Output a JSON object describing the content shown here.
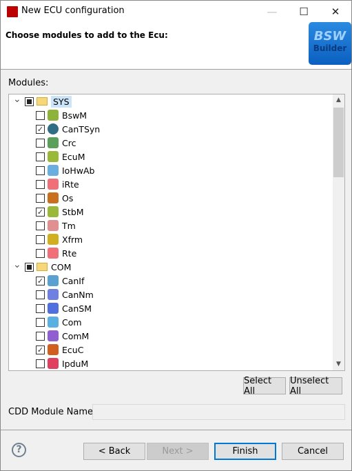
{
  "window": {
    "title": "New ECU configuration",
    "minimize": "—",
    "maximize": "☐",
    "close": "✕"
  },
  "header": {
    "heading": "Choose modules to add to the Ecu:",
    "logo_text": "BSW Builder",
    "logo_line1": "BSW",
    "logo_line2": "Builder"
  },
  "modules_label": "Modules:",
  "tree": [
    {
      "label": "SYS",
      "state": "partial",
      "expanded": true,
      "children": [
        {
          "label": "BswM",
          "checked": false,
          "icon": "bswm-icon",
          "color": "#8db33a"
        },
        {
          "label": "CanTSyn",
          "checked": true,
          "icon": "cantsyn-icon",
          "color": "#2f6e84"
        },
        {
          "label": "Crc",
          "checked": false,
          "icon": "crc-icon",
          "color": "#5aa05a"
        },
        {
          "label": "EcuM",
          "checked": false,
          "icon": "ecum-icon",
          "color": "#9ab83a"
        },
        {
          "label": "IoHwAb",
          "checked": false,
          "icon": "iohwab-icon",
          "color": "#6aaee0"
        },
        {
          "label": "iRte",
          "checked": false,
          "icon": "irte-icon",
          "color": "#f0707a"
        },
        {
          "label": "Os",
          "checked": false,
          "icon": "os-gears-icon",
          "color": "#c87020"
        },
        {
          "label": "StbM",
          "checked": true,
          "icon": "stbm-icon",
          "color": "#9ab83a"
        },
        {
          "label": "Tm",
          "checked": false,
          "icon": "tm-icon",
          "color": "#e09090"
        },
        {
          "label": "Xfrm",
          "checked": false,
          "icon": "xfrm-icon",
          "color": "#d0b020"
        },
        {
          "label": "Rte",
          "checked": false,
          "icon": "rte-icon",
          "color": "#f0707a"
        }
      ]
    },
    {
      "label": "COM",
      "state": "partial",
      "expanded": true,
      "children": [
        {
          "label": "CanIf",
          "checked": true,
          "icon": "canif-icon",
          "color": "#5aa0d0"
        },
        {
          "label": "CanNm",
          "checked": false,
          "icon": "cannm-icon",
          "color": "#7080e0"
        },
        {
          "label": "CanSM",
          "checked": false,
          "icon": "cansm-icon",
          "color": "#5070e0"
        },
        {
          "label": "Com",
          "checked": false,
          "icon": "com-icon",
          "color": "#5ab0e0"
        },
        {
          "label": "ComM",
          "checked": false,
          "icon": "comm-icon",
          "color": "#9060d0"
        },
        {
          "label": "EcuC",
          "checked": true,
          "icon": "ecuc-icon",
          "color": "#d06020"
        },
        {
          "label": "IpduM",
          "checked": false,
          "icon": "ipdum-icon",
          "color": "#e04060"
        }
      ]
    }
  ],
  "buttons": {
    "select_all": "Select All",
    "unselect_all": "Unselect All",
    "back": "< Back",
    "next": "Next >",
    "finish": "Finish",
    "cancel": "Cancel",
    "help": "?"
  },
  "cdd": {
    "label": "CDD Module Name:",
    "value": ""
  }
}
